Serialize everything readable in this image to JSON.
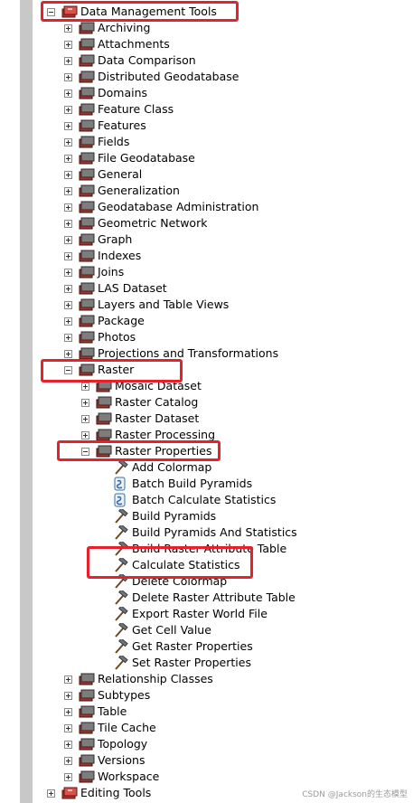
{
  "tree": {
    "root": {
      "label": "Data Management Tools"
    },
    "items": [
      "Archiving",
      "Attachments",
      "Data Comparison",
      "Distributed Geodatabase",
      "Domains",
      "Feature Class",
      "Features",
      "Fields",
      "File Geodatabase",
      "General",
      "Generalization",
      "Geodatabase Administration",
      "Geometric Network",
      "Graph",
      "Indexes",
      "Joins",
      "LAS Dataset",
      "Layers and Table Views",
      "Package",
      "Photos",
      "Projections and Transformations"
    ],
    "raster": {
      "label": "Raster",
      "children": [
        "Mosaic Dataset",
        "Raster Catalog",
        "Raster Dataset",
        "Raster Processing"
      ],
      "properties": {
        "label": "Raster Properties",
        "tools": [
          {
            "label": "Add Colormap",
            "icon": "hammer"
          },
          {
            "label": "Batch Build Pyramids",
            "icon": "script"
          },
          {
            "label": "Batch Calculate Statistics",
            "icon": "script"
          },
          {
            "label": "Build Pyramids",
            "icon": "hammer"
          },
          {
            "label": "Build Pyramids And Statistics",
            "icon": "hammer"
          },
          {
            "label": "Build Raster Attribute Table",
            "icon": "hammer"
          },
          {
            "label": "Calculate Statistics",
            "icon": "hammer"
          },
          {
            "label": "Delete Colormap",
            "icon": "hammer"
          },
          {
            "label": "Delete Raster Attribute Table",
            "icon": "hammer"
          },
          {
            "label": "Export Raster World File",
            "icon": "hammer"
          },
          {
            "label": "Get Cell Value",
            "icon": "hammer"
          },
          {
            "label": "Get Raster Properties",
            "icon": "hammer"
          },
          {
            "label": "Set Raster Properties",
            "icon": "hammer"
          }
        ]
      }
    },
    "after_items": [
      "Relationship Classes",
      "Subtypes",
      "Table",
      "Tile Cache",
      "Topology",
      "Versions",
      "Workspace"
    ],
    "next_root": {
      "label": "Editing Tools"
    }
  },
  "colors": {
    "highlight": "#e8202a",
    "toolbox_red": "#c0392b"
  },
  "watermark": "CSDN @Jackson的生态模型"
}
